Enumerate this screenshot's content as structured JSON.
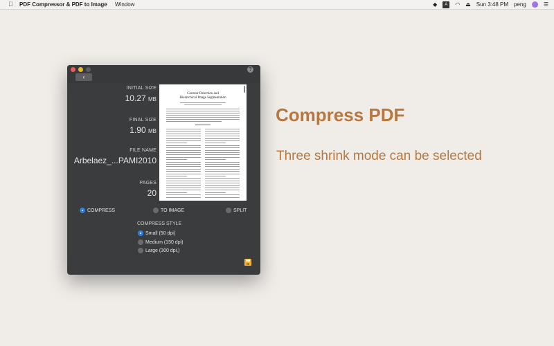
{
  "menubar": {
    "apple": "",
    "app_name": "PDF Compressor & PDF to Image",
    "menu_window": "Window",
    "status_a": "A",
    "clock": "Sun 3:48 PM",
    "user": "peng"
  },
  "window": {
    "back_label": "‹",
    "help_label": "?",
    "initial_size_label": "INITIAL SIZE",
    "initial_size_value": "10.27",
    "initial_size_unit": "MB",
    "final_size_label": "FINAL SIZE",
    "final_size_value": "1.90",
    "final_size_unit": "MB",
    "file_name_label": "FILE NAME",
    "file_name_value": "Arbelaez_...PAMI2010",
    "pages_label": "PAGES",
    "pages_value": "20",
    "preview": {
      "title_line1": "Contour Detection and",
      "title_line2": "Hierarchical Image Segmentation"
    },
    "modes": [
      {
        "label": "COMPRESS",
        "selected": true
      },
      {
        "label": "TO IMAGE",
        "selected": false
      },
      {
        "label": "SPLIT",
        "selected": false
      }
    ],
    "compress_style_label": "COMPRESS STYLE",
    "styles": [
      {
        "label": "Small (50 dpi)",
        "selected": true
      },
      {
        "label": "Medium (150 dpi)",
        "selected": false
      },
      {
        "label": "Large (300 dpi,)",
        "selected": false
      }
    ]
  },
  "promo": {
    "headline": "Compress PDF",
    "subline": "Three shrink mode can be selected"
  },
  "colors": {
    "accent": "#b7773e",
    "radio_selected": "#2f7fe8",
    "window_bg": "#3b3c3e",
    "desktop_bg": "#f0ece8"
  }
}
